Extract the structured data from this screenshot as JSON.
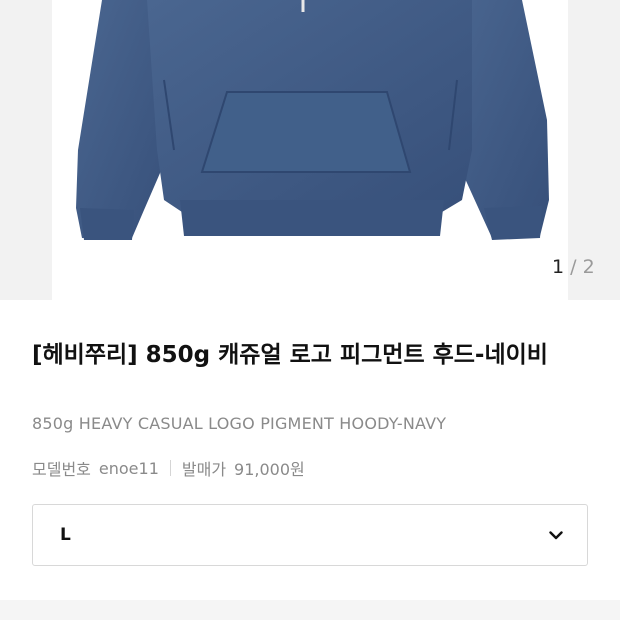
{
  "gallery": {
    "current": "1",
    "separator": "/",
    "total": "2",
    "hoodie_color": "#3f5a82"
  },
  "product": {
    "title": "[헤비쭈리] 850g 캐쥬얼 로고 피그먼트 후드-네이비",
    "english_name": "850g HEAVY CASUAL LOGO PIGMENT HOODY-NAVY",
    "model_label": "모델번호",
    "model_value": "enoe11",
    "price_label": "발매가",
    "price_value": "91,000원"
  },
  "size_select": {
    "value": "L",
    "icon": "chevron-down-icon"
  }
}
